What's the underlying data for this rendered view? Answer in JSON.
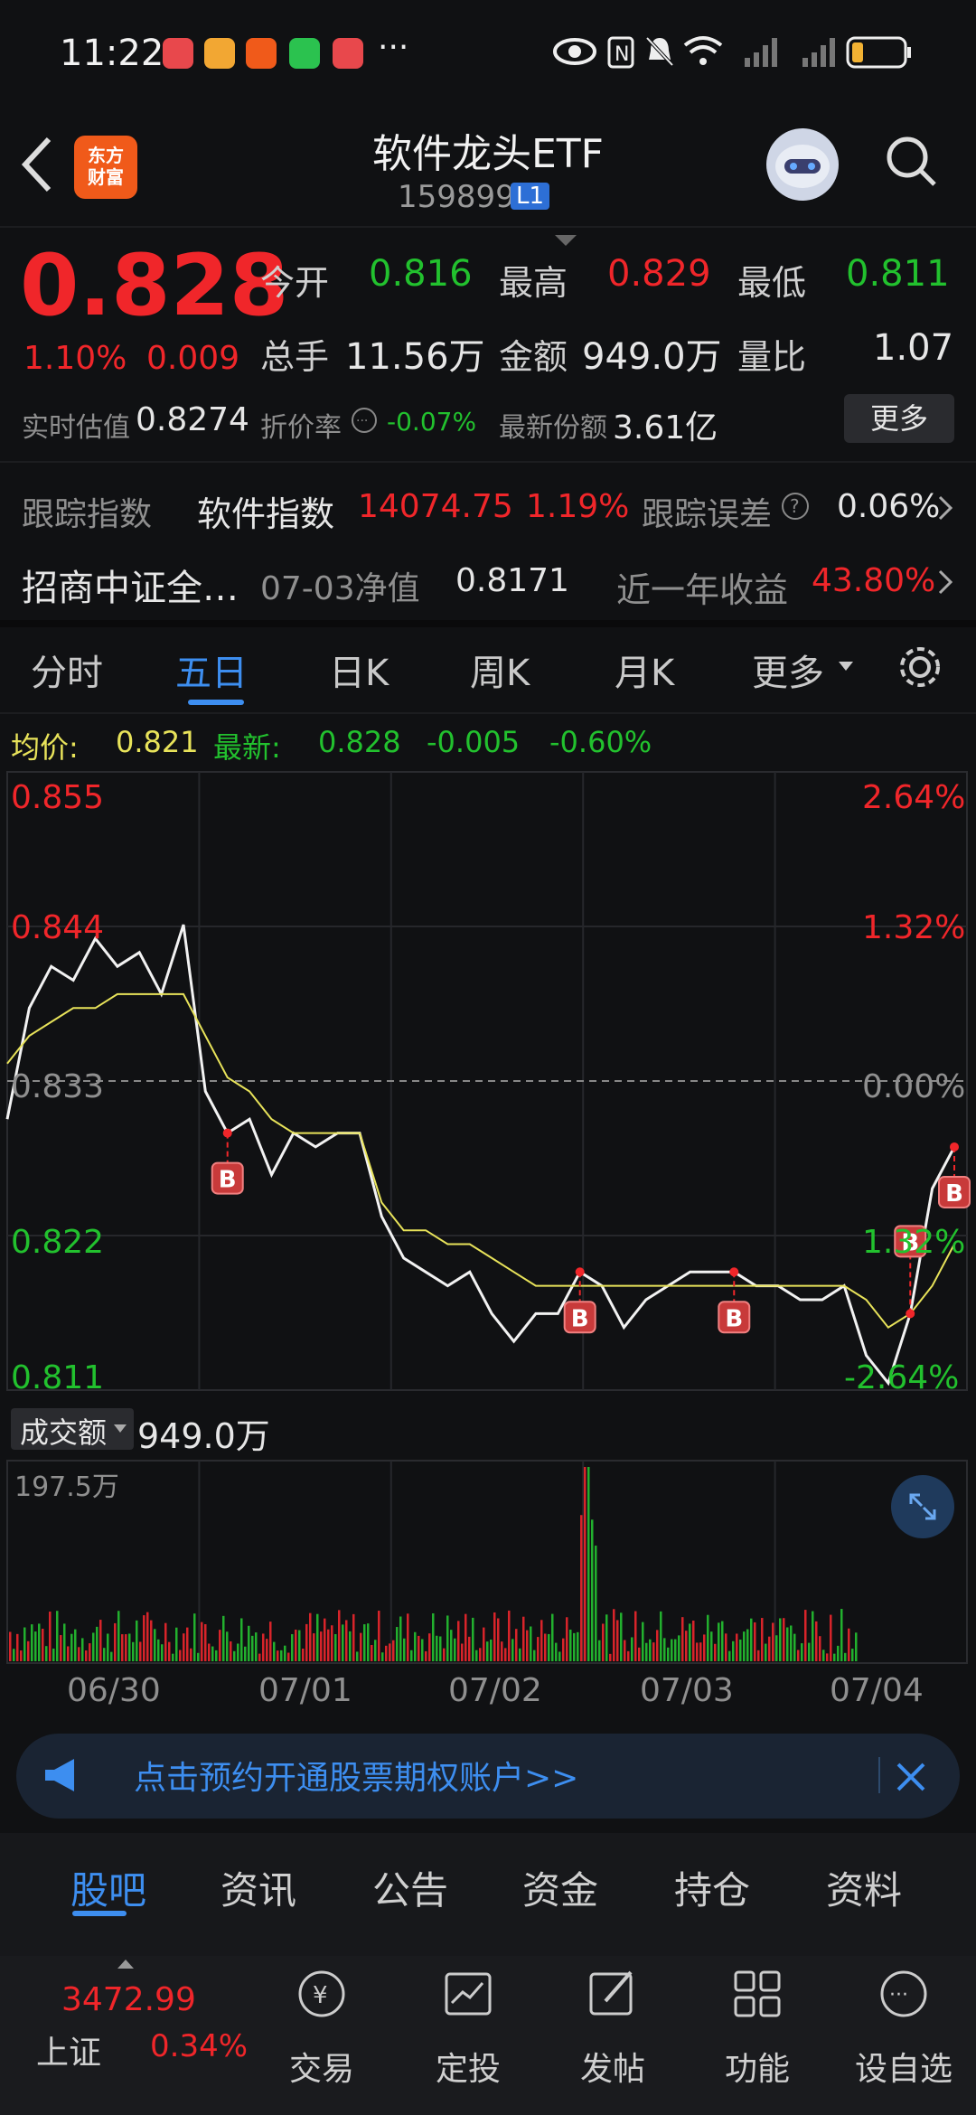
{
  "status_bar": {
    "time": "11:22",
    "more": "···"
  },
  "header": {
    "title": "软件龙头ETF",
    "code": "159899",
    "level": "L1",
    "logo_text_1": "东方",
    "logo_text_2": "财富"
  },
  "quote": {
    "price": "0.828",
    "change_pct": "1.10%",
    "change": "0.009",
    "open_label": "今开",
    "open": "0.816",
    "high_label": "最高",
    "high": "0.829",
    "low_label": "最低",
    "low": "0.811",
    "volume_label": "总手",
    "volume": "11.56万",
    "amount_label": "金额",
    "amount": "949.0万",
    "ratio_label": "量比",
    "ratio": "1.07",
    "iopv_label": "实时估值",
    "iopv": "0.8274",
    "discount_label": "折价率",
    "discount": "-0.07%",
    "shares_label": "最新份额",
    "shares": "3.61亿",
    "more_label": "更多"
  },
  "tracking": {
    "index_label": "跟踪指数",
    "index_name": "软件指数",
    "index_value": "14074.75",
    "index_pct": "1.19%",
    "error_label": "跟踪误差",
    "error": "0.06%",
    "fund_name": "招商中证全…",
    "nav_label": "07-03净值",
    "nav": "0.8171",
    "year_label": "近一年收益",
    "year_return": "43.80%"
  },
  "tabs": [
    "分时",
    "五日",
    "日K",
    "周K",
    "月K",
    "更多"
  ],
  "chart_header": {
    "avg_label": "均价:",
    "avg": "0.821",
    "latest_label": "最新:",
    "latest": "0.828",
    "chg": "-0.005",
    "chg_pct": "-0.60%"
  },
  "chart_data": {
    "type": "line",
    "y_ticks": [
      "0.855",
      "0.844",
      "0.833",
      "0.822",
      "0.811"
    ],
    "pct_ticks": [
      "2.64%",
      "1.32%",
      "0.00%",
      "1.32%",
      "-2.64%"
    ],
    "ylim": [
      0.811,
      0.855
    ],
    "x_labels": [
      "06/30",
      "07/01",
      "07/02",
      "07/03",
      "07/04"
    ],
    "series": [
      {
        "values": [
          0.83,
          0.838,
          0.841,
          0.84,
          0.843,
          0.841,
          0.842,
          0.839,
          0.844,
          0.832,
          0.829,
          0.83,
          0.826,
          0.829,
          0.828,
          0.829,
          0.829,
          0.823,
          0.82,
          0.819,
          0.818,
          0.819,
          0.816,
          0.814,
          0.816,
          0.816,
          0.819,
          0.818,
          0.815,
          0.817,
          0.818,
          0.819,
          0.819,
          0.819,
          0.818,
          0.818,
          0.817,
          0.817,
          0.818,
          0.813,
          0.811,
          0.816,
          0.825,
          0.828
        ]
      },
      {
        "values": [
          0.834,
          0.836,
          0.837,
          0.838,
          0.838,
          0.839,
          0.839,
          0.839,
          0.839,
          0.836,
          0.833,
          0.832,
          0.83,
          0.829,
          0.829,
          0.829,
          0.829,
          0.824,
          0.822,
          0.822,
          0.821,
          0.821,
          0.82,
          0.819,
          0.818,
          0.818,
          0.818,
          0.818,
          0.818,
          0.818,
          0.818,
          0.818,
          0.818,
          0.818,
          0.818,
          0.818,
          0.818,
          0.818,
          0.818,
          0.817,
          0.815,
          0.816,
          0.818,
          0.821
        ]
      }
    ],
    "markers": [
      "B",
      "B",
      "B",
      "B",
      "B"
    ],
    "volume_label": "成交额",
    "volume_value": "949.0万",
    "volume_max": "197.5万"
  },
  "banner": {
    "text": "点击预约开通股票期权账户>>"
  },
  "bottom_tabs": [
    "股吧",
    "资讯",
    "公告",
    "资金",
    "持仓",
    "资料"
  ],
  "bottom_nav": {
    "index_value": "3472.99",
    "index_name": "上证",
    "index_pct": "0.34%",
    "items": [
      "交易",
      "定投",
      "发帖",
      "功能",
      "设自选"
    ]
  },
  "colors": {
    "up": "#f0262a",
    "down": "#22c12e",
    "accent": "#3d8ef0",
    "avg_line": "#e8e35a"
  }
}
